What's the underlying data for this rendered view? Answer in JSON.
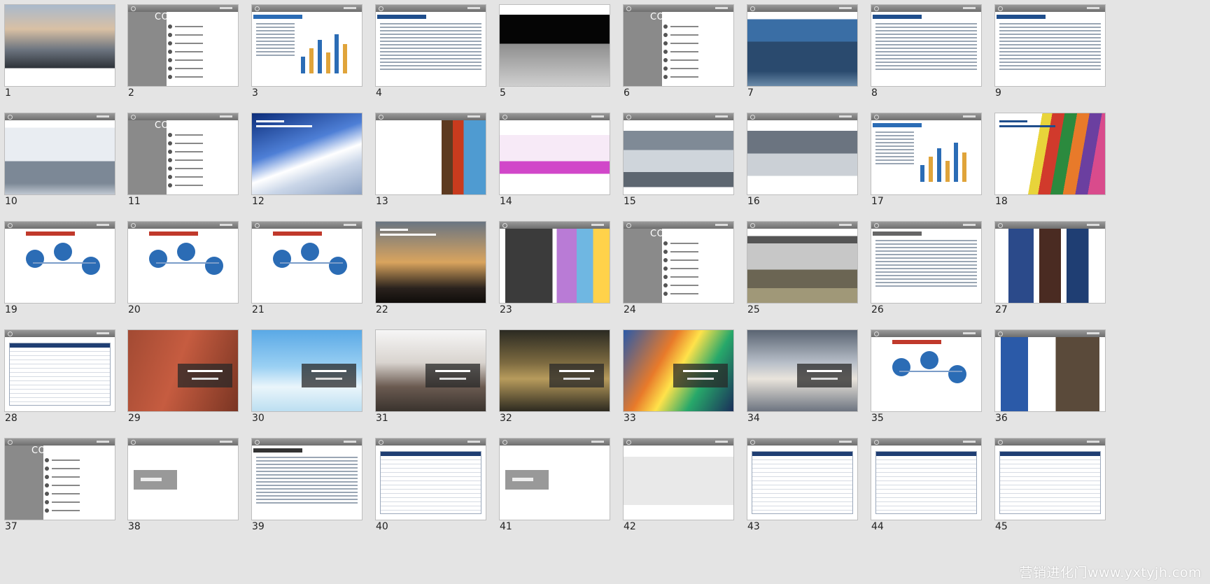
{
  "watermark": "营销进化门www.yxtyjh.com",
  "toc_title": "CONTENTS",
  "slides": [
    {
      "n": "1",
      "kind": "photo",
      "bg": "linear-gradient(#a9b9cc 0%,#d9c0a4 30%,#6d7580 55%,#2d3238 78%,#ffffff 78%)"
    },
    {
      "n": "2",
      "kind": "toc"
    },
    {
      "n": "3",
      "kind": "chart"
    },
    {
      "n": "4",
      "kind": "text"
    },
    {
      "n": "5",
      "kind": "photo",
      "bg": "linear-gradient(#ffffff 0 12%,#050505 12% 48%,#8e8e8e 48%,#cfcfcf 100%)"
    },
    {
      "n": "6",
      "kind": "toc"
    },
    {
      "n": "7",
      "kind": "photo",
      "bg": "linear-gradient(#ffffff 0 10%,#3a6ea5 10% 40%,#2a4a6e 40% 80%,#6a8aa8 100%)"
    },
    {
      "n": "8",
      "kind": "text",
      "accent": "#1f4e8c"
    },
    {
      "n": "9",
      "kind": "text",
      "accent": "#1f4e8c"
    },
    {
      "n": "10",
      "kind": "photo",
      "bg": "linear-gradient(#ffffff 0 10%,#e9edf2 10% 55%,#7c8896 55% 85%,#c0c8d2 100%)"
    },
    {
      "n": "11",
      "kind": "toc"
    },
    {
      "n": "12",
      "kind": "photo",
      "bg": "linear-gradient(160deg,#0c2d7a 0%,#4e7fd6 40%,#ffffff 58%,#cad6e8 72%,#8ea3c4 100%)"
    },
    {
      "n": "13",
      "kind": "photo",
      "bg": "linear-gradient(90deg,#ffffff 0 60%,#5d3a20 60% 70%,#c83b1e 70% 80%,#4f9bd1 80%)"
    },
    {
      "n": "14",
      "kind": "photo",
      "bg": "linear-gradient(#ffffff 0 20%,#f7eaf7 20% 55%,#d147c9 55% 72%,#ffffff 72%)"
    },
    {
      "n": "15",
      "kind": "photo",
      "bg": "linear-gradient(#ffffff 0 14%,#7f8a96 14% 40%,#cfd5db 40% 70%,#5d6670 70% 90%,#ffffff 90%)"
    },
    {
      "n": "16",
      "kind": "photo",
      "bg": "linear-gradient(#ffffff 0 14%,#6b7480 14% 45%,#cbd0d6 45% 75%,#ffffff 75%)"
    },
    {
      "n": "17",
      "kind": "chart"
    },
    {
      "n": "18",
      "kind": "photo",
      "bg": "linear-gradient(100deg,#ffffff 0 38%,#e8d43a 38% 46%,#d13a2c 46% 56%,#2b8a3e 56% 66%,#e87a2a 66% 76%,#6b3fa0 76% 86%,#d94b8c 86%)"
    },
    {
      "n": "19",
      "kind": "diagram"
    },
    {
      "n": "20",
      "kind": "diagram"
    },
    {
      "n": "21",
      "kind": "diagram"
    },
    {
      "n": "22",
      "kind": "photo",
      "bg": "linear-gradient(#6a7582 0%,#d9a45e 50%,#2a221d 82%,#0f0c0a 100%)"
    },
    {
      "n": "23",
      "kind": "photo",
      "bg": "linear-gradient(90deg,#ffffff 0 5%,#3b3b3b 5% 48%,#ffffff 48% 52%,#b97bd6 52% 70%,#6fb7e2 70% 85%,#ffd24a 85%)"
    },
    {
      "n": "24",
      "kind": "toc"
    },
    {
      "n": "25",
      "kind": "photo",
      "bg": "linear-gradient(#ffffff 0 10%,#555 10% 20%,#c7c7c7 20% 55%,#6b6553 55% 80%,#a09878 80%)"
    },
    {
      "n": "26",
      "kind": "text",
      "accent": "#666"
    },
    {
      "n": "27",
      "kind": "photo",
      "bg": "linear-gradient(90deg,#ffffff 0 12%,#2b4a8a 12% 35%,#ffffff 35% 40%,#4a2b22 40% 60%,#ffffff 60% 65%,#1f3e73 65% 85%,#ffffff 85%)"
    },
    {
      "n": "28",
      "kind": "table"
    },
    {
      "n": "29",
      "kind": "photo",
      "bg": "linear-gradient(110deg,#a24a33 0%,#c65c40 45%,#7a3523 100%)"
    },
    {
      "n": "30",
      "kind": "photo",
      "bg": "linear-gradient(#5aa9e6 0%,#9ad0f3 45%,#eaf5fb 70%,#bcdff1 100%)"
    },
    {
      "n": "31",
      "kind": "photo",
      "bg": "linear-gradient(#f6f6f6 0%,#d9d4cf 40%,#6a5a50 70%,#3a332e 100%)"
    },
    {
      "n": "32",
      "kind": "photo",
      "bg": "linear-gradient(#2b2a22 0%,#7c6a40 40%,#b79b5c 60%,#2d2a20 100%)"
    },
    {
      "n": "33",
      "kind": "photo",
      "bg": "linear-gradient(120deg,#2b5aa8 0%,#e87a2a 35%,#ffe24a 50%,#27a86a 70%,#1a2e5a 100%)"
    },
    {
      "n": "34",
      "kind": "photo",
      "bg": "linear-gradient(#5a6472 0%,#b7bec8 40%,#e9e4dc 60%,#6d7480 100%)"
    },
    {
      "n": "35",
      "kind": "diagram"
    },
    {
      "n": "36",
      "kind": "photo",
      "bg": "linear-gradient(90deg,#ffffff 0 5%,#2b5aa8 5% 30%,#ffffff 30% 55%,#5a4a3a 55% 95%,#ffffff 95%)"
    },
    {
      "n": "37",
      "kind": "toc"
    },
    {
      "n": "38",
      "kind": "banner"
    },
    {
      "n": "39",
      "kind": "text",
      "accent": "#333"
    },
    {
      "n": "40",
      "kind": "table"
    },
    {
      "n": "41",
      "kind": "banner"
    },
    {
      "n": "42",
      "kind": "photo",
      "bg": "linear-gradient(#ffffff 0 15%,#e9e9e9 15% 80%,#ffffff 80%)"
    },
    {
      "n": "43",
      "kind": "table"
    },
    {
      "n": "44",
      "kind": "table"
    },
    {
      "n": "45",
      "kind": "table"
    }
  ]
}
